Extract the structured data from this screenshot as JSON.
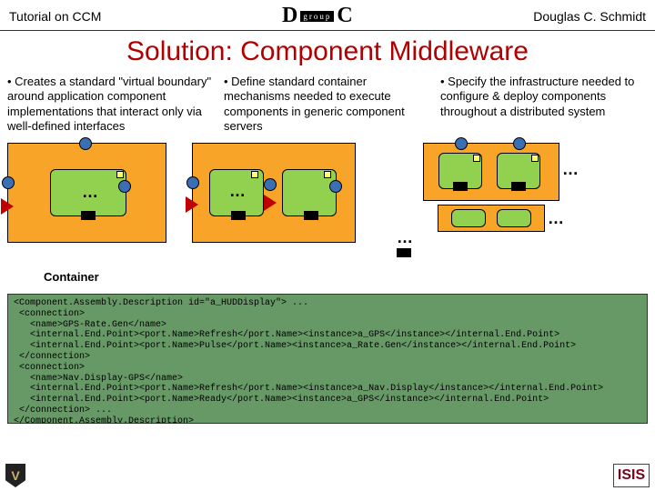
{
  "header": {
    "left": "Tutorial on CCM",
    "right": "Douglas C. Schmidt",
    "logo_left": "D",
    "logo_tag": "group",
    "logo_right": "C"
  },
  "title": "Solution: Component Middleware",
  "cols": {
    "c1": "• Creates a standard \"virtual boundary\" around application component implementations that interact only via well-defined interfaces",
    "c2": "• Define standard container mechanisms needed to execute components in generic component servers",
    "c3": "• Specify the infrastructure needed to configure & deploy components throughout a distributed system"
  },
  "label_container": "Container",
  "ellipsis": "…",
  "xml": "<Component.Assembly.Description id=\"a_HUDDisplay\"> ...\n <connection>\n   <name>GPS-Rate.Gen</name>\n   <internal.End.Point><port.Name>Refresh</port.Name><instance>a_GPS</instance></internal.End.Point>\n   <internal.End.Point><port.Name>Pulse</port.Name><instance>a_Rate.Gen</instance></internal.End.Point>\n </connection>\n <connection>\n   <name>Nav.Display-GPS</name>\n   <internal.End.Point><port.Name>Refresh</port.Name><instance>a_Nav.Display</instance></internal.End.Point>\n   <internal.End.Point><port.Name>Ready</port.Name><instance>a_GPS</instance></internal.End.Point>\n </connection> ...\n</Component.Assembly.Description>",
  "footer": {
    "left": "V",
    "right": "ISIS"
  }
}
